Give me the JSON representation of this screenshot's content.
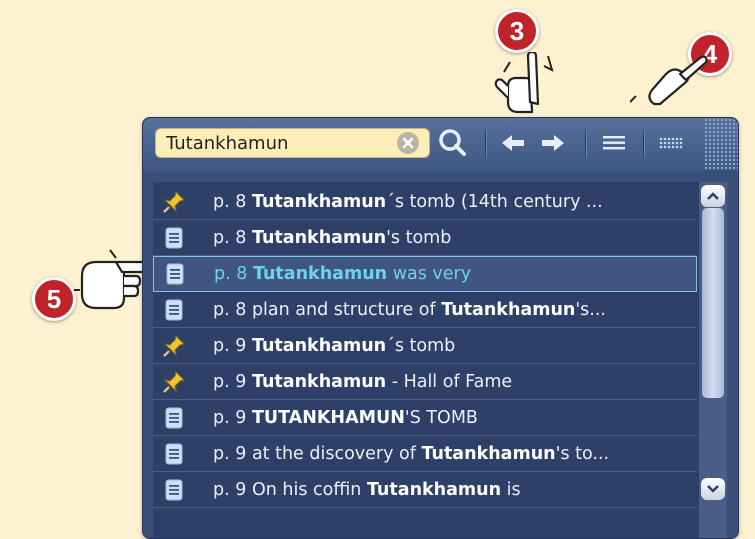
{
  "search": {
    "value": "Tutankhamun",
    "placeholder": ""
  },
  "toolbar": {
    "icons": [
      "clear-icon",
      "search-icon",
      "back-arrow-icon",
      "forward-arrow-icon",
      "list-view-icon",
      "grid-view-icon"
    ]
  },
  "results": [
    {
      "type": "pin",
      "page": "p. 8",
      "pre": "",
      "bold": "Tutankhamun",
      "post": "´s tomb (14th century ...",
      "selected": false
    },
    {
      "type": "note",
      "page": "p. 8",
      "pre": "",
      "bold": "Tutankhamun",
      "post": "'s tomb",
      "selected": false
    },
    {
      "type": "note",
      "page": "p. 8",
      "pre": "",
      "bold": "Tutankhamun",
      "post": " was very",
      "selected": true
    },
    {
      "type": "note",
      "page": "p. 8",
      "pre": "plan and structure of ",
      "bold": "Tutankhamun",
      "post": "'s...",
      "selected": false
    },
    {
      "type": "pin",
      "page": "p. 9",
      "pre": "",
      "bold": "Tutankhamun",
      "post": "´s tomb",
      "selected": false
    },
    {
      "type": "pin",
      "page": "p. 9",
      "pre": "",
      "bold": "Tutankhamun",
      "post": " - Hall of Fame",
      "selected": false
    },
    {
      "type": "note",
      "page": "p. 9",
      "pre": "",
      "bold": "TUTANKHAMUN",
      "post": "'S TOMB",
      "selected": false
    },
    {
      "type": "note",
      "page": "p. 9",
      "pre": "at the discovery of ",
      "bold": "Tutankhamun",
      "post": "'s to...",
      "selected": false
    },
    {
      "type": "note",
      "page": "p. 9",
      "pre": "On his coffin ",
      "bold": "Tutankhamun",
      "post": " is",
      "selected": false
    }
  ],
  "callouts": {
    "c3": "3",
    "c4": "4",
    "c5": "5"
  },
  "colors": {
    "badge": "#c0242b",
    "panel": "#3b4f78",
    "highlight": "#6bd3ef",
    "background": "#fdf1cf"
  }
}
